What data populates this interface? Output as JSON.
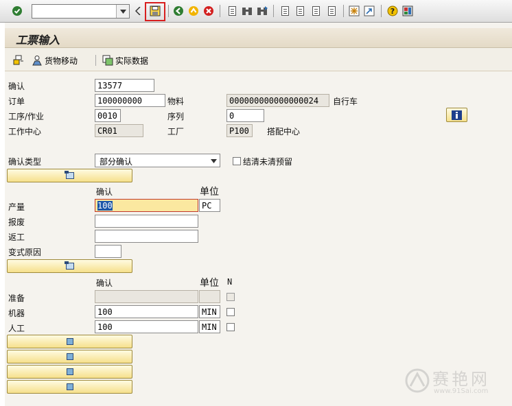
{
  "toolbar": {
    "command_field": {
      "value": "",
      "placeholder": ""
    },
    "icons": [
      "enter-icon",
      "save-icon",
      "back-icon",
      "exit-icon",
      "cancel-icon",
      "print-icon",
      "find-icon",
      "find-next-icon",
      "first-page-icon",
      "prev-page-icon",
      "next-page-icon",
      "last-page-icon",
      "new-session-icon",
      "shortcut-icon",
      "help-icon",
      "layout-icon"
    ],
    "highlighted_button": "save-icon"
  },
  "header": {
    "title": "工票输入"
  },
  "app_toolbar": {
    "goods_movement": "货物移动",
    "actual_data": "实际数据"
  },
  "form": {
    "confirmation": {
      "label": "确认",
      "value": "13577"
    },
    "order": {
      "label": "订单",
      "value": "100000000"
    },
    "material": {
      "label": "物料",
      "value": "000000000000000024",
      "description": "自行车"
    },
    "operation": {
      "label": "工序/作业",
      "value": "0010"
    },
    "sequence": {
      "label": "序列",
      "value": "0"
    },
    "work_center": {
      "label": "工作中心",
      "value": "CR01"
    },
    "plant": {
      "label": "工厂",
      "value": "P100",
      "description": "搭配中心"
    },
    "confirmation_type": {
      "label": "确认类型",
      "value": "部分确认"
    },
    "clear_reservations": {
      "label": "结清未清预留",
      "checked": false
    }
  },
  "quantities": {
    "col_confirm": "确认",
    "col_unit": "单位",
    "yield": {
      "label": "产量",
      "value": "100",
      "unit": "PC"
    },
    "scrap": {
      "label": "报废",
      "value": ""
    },
    "rework": {
      "label": "返工",
      "value": ""
    },
    "variance_reason": {
      "label": "变式原因",
      "value": ""
    }
  },
  "activities": {
    "col_confirm": "确认",
    "col_unit": "单位",
    "col_n": "N",
    "setup": {
      "label": "准备",
      "value": "",
      "unit": ""
    },
    "machine": {
      "label": "机器",
      "value": "100",
      "unit": "MIN"
    },
    "labor": {
      "label": "人工",
      "value": "100",
      "unit": "MIN"
    }
  },
  "watermark": {
    "text": "赛艳网",
    "url": "www.91Sai.com"
  },
  "colors": {
    "highlight_border": "#d81e1e",
    "active_field": "#fbe8a0",
    "selection": "#1b56a8",
    "button_yellow": "#f6e08c"
  }
}
